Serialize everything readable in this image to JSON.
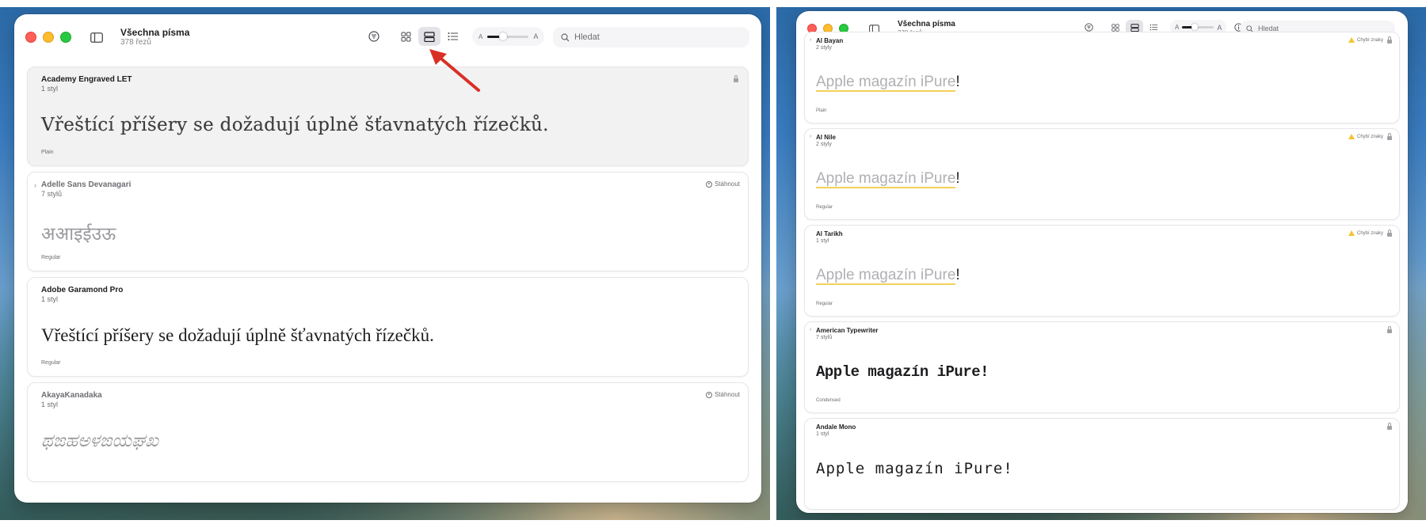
{
  "window": {
    "title": "Všechna písma",
    "subtitle": "378 řezů"
  },
  "search": {
    "placeholder": "Hledat"
  },
  "slider": {
    "small_label": "A",
    "large_label": "A",
    "value": 0.3
  },
  "toolbar": {
    "filter_icon": "filter-circle-icon",
    "views": [
      "grid-view-icon",
      "strip-view-icon",
      "list-view-icon"
    ],
    "active_view": "strip-view-icon",
    "info_icon": "info-icon"
  },
  "left_panel": {
    "fonts": [
      {
        "name": "Academy Engraved LET",
        "count": "1 styl",
        "sample": "Vřeštící příšery se dožadují úplně šťavnatých řízečků.",
        "style": "Plain",
        "selected": true
      },
      {
        "name": "Adelle Sans Devanagari",
        "count": "7 stylů",
        "sample": "अआइईउऊ",
        "style": "Regular",
        "action": "Stáhnout"
      },
      {
        "name": "Adobe Garamond Pro",
        "count": "1 styl",
        "sample": "Vřeštící příšery se dožadují úplně šťavnatých řízečků.",
        "style": "Regular"
      },
      {
        "name": "AkayaKanadaka",
        "count": "1 styl",
        "sample": "ಥಙಹಅಳಙಯಘಖ",
        "action": "Stáhnout"
      }
    ]
  },
  "right_panel": {
    "fonts": [
      {
        "name": "Al Bayan",
        "count": "2 styly",
        "sample": "Apple magazín iPure",
        "sample_end": "!",
        "style": "Plain",
        "warning": "Chybí znaky"
      },
      {
        "name": "Al Nile",
        "count": "2 styly",
        "sample": "Apple magazín iPure",
        "sample_end": "!",
        "style": "Regular",
        "warning": "Chybí znaky"
      },
      {
        "name": "Al Tarikh",
        "count": "1 styl",
        "sample": "Apple magazín iPure",
        "sample_end": "!",
        "style": "Regular",
        "warning": "Chybí znaky"
      },
      {
        "name": "American Typewriter",
        "count": "7 stylů",
        "sample": "Apple magazín iPure!",
        "style": "Condensed"
      },
      {
        "name": "Andale Mono",
        "count": "1 styl",
        "sample": "Apple magazín iPure!"
      }
    ]
  },
  "colors": {
    "accent": "#1d1d1f",
    "warning": "#f4c430",
    "arrow": "#d93025"
  }
}
